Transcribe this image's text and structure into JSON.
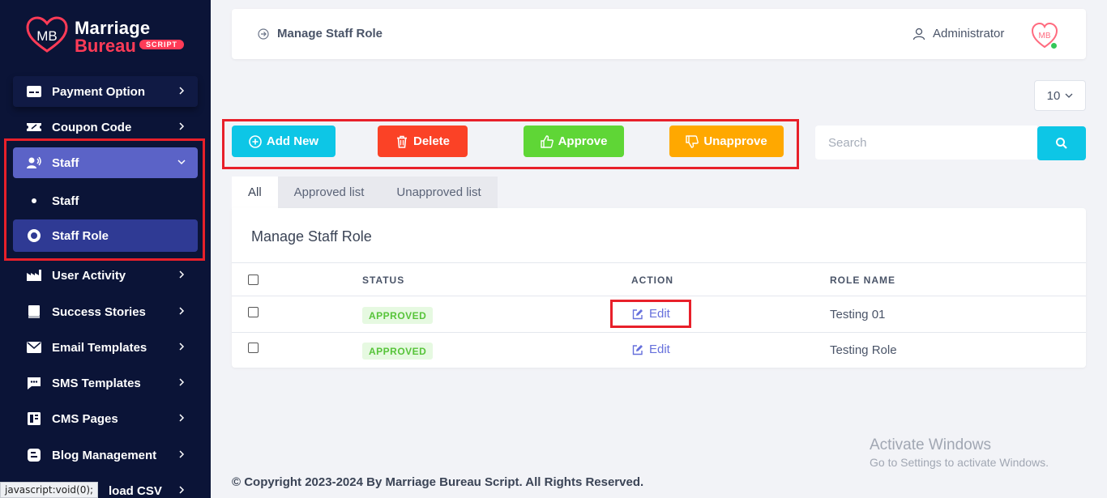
{
  "brand": {
    "line1": "Marriage",
    "line2": "Bureau",
    "tag": "SCRIPT",
    "mark": "MB"
  },
  "sidebar": {
    "items": [
      {
        "label": "Payment Option"
      },
      {
        "label": "Coupon Code"
      },
      {
        "label": "Staff"
      },
      {
        "label": "Staff"
      },
      {
        "label": "Staff Role"
      },
      {
        "label": "User Activity"
      },
      {
        "label": "Success Stories"
      },
      {
        "label": "Email Templates"
      },
      {
        "label": "SMS Templates"
      },
      {
        "label": "CMS Pages"
      },
      {
        "label": "Blog Management"
      },
      {
        "label": "load CSV"
      }
    ]
  },
  "status_tip": "javascript:void(0);",
  "header": {
    "breadcrumb": "Manage Staff Role",
    "user": "Administrator"
  },
  "page_size": {
    "value": "10"
  },
  "actions": {
    "add": "Add New",
    "delete": "Delete",
    "approve": "Approve",
    "unapprove": "Unapprove"
  },
  "search": {
    "placeholder": "Search"
  },
  "tabs": [
    {
      "label": "All"
    },
    {
      "label": "Approved list"
    },
    {
      "label": "Unapproved list"
    }
  ],
  "card": {
    "title": "Manage Staff Role",
    "columns": {
      "status": "STATUS",
      "action": "ACTION",
      "role_name": "ROLE NAME"
    },
    "rows": [
      {
        "status": "APPROVED",
        "action": "Edit",
        "role_name": "Testing 01"
      },
      {
        "status": "APPROVED",
        "action": "Edit",
        "role_name": "Testing Role"
      }
    ]
  },
  "footer": "© Copyright 2023-2024 By Marriage Bureau Script. All Rights Reserved.",
  "watermark": {
    "line1": "Activate Windows",
    "line2": "Go to Settings to activate Windows."
  },
  "colors": {
    "sidebar": "#0b1437",
    "accent": "#0dc6e6",
    "danger": "#fb4226",
    "success": "#5fd636",
    "warning": "#ffa800",
    "active_item": "#5b63c7"
  }
}
